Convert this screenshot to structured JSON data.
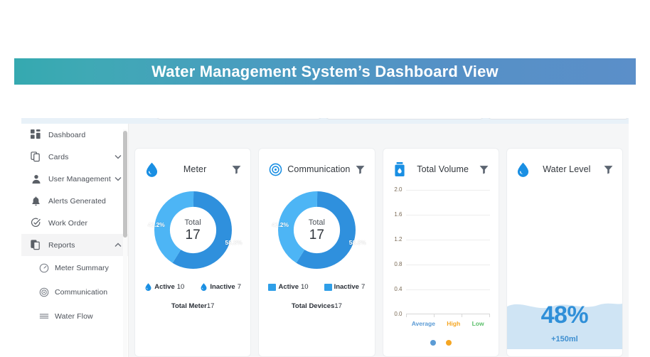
{
  "banner": {
    "title": "Water Management System’s Dashboard View"
  },
  "theme": {
    "banner_gradient_start": "#35a9b0",
    "banner_gradient_end": "#5b8fc9",
    "accent_blue": "#1a8fe3",
    "donut_dark": "#2f90dd",
    "donut_light": "#4db5f5",
    "water_fill": "#cfe4f4",
    "water_text": "#2f8fd8"
  },
  "sidebar": {
    "items": [
      {
        "label": "Dashboard",
        "icon": "dashboard-grid-icon",
        "chevron": "",
        "active": false
      },
      {
        "label": "Cards",
        "icon": "cards-copy-icon",
        "chevron": "down",
        "active": false
      },
      {
        "label": "User Management",
        "icon": "user-icon",
        "chevron": "down",
        "active": false
      },
      {
        "label": "Alerts Generated",
        "icon": "bell-icon",
        "chevron": "",
        "active": false
      },
      {
        "label": "Work Order",
        "icon": "check-circle-icon",
        "chevron": "",
        "active": false
      },
      {
        "label": "Reports",
        "icon": "reports-document-icon",
        "chevron": "up",
        "active": true
      }
    ],
    "sub_items": [
      {
        "label": "Meter Summary",
        "icon": "gauge-icon"
      },
      {
        "label": "Communication",
        "icon": "signal-icon"
      },
      {
        "label": "Water Flow",
        "icon": "flow-lines-icon"
      }
    ]
  },
  "cards": [
    {
      "id": "meter",
      "title": "Meter",
      "icon": "water-drop-icon",
      "filter_icon": "filter-funnel-icon",
      "center_label": "Total",
      "center_value": "17",
      "legend_marker": "drop",
      "legend": [
        {
          "label": "Active",
          "value": "10"
        },
        {
          "label": "Inactive",
          "value": "7"
        }
      ],
      "footer_label": "Total Meter",
      "footer_value": "17"
    },
    {
      "id": "communication",
      "title": "Communication",
      "icon": "signal-icon",
      "filter_icon": "filter-funnel-icon",
      "center_label": "Total",
      "center_value": "17",
      "legend_marker": "square",
      "legend": [
        {
          "label": "Active",
          "value": "10"
        },
        {
          "label": "Inactive",
          "value": "7"
        }
      ],
      "footer_label": "Total Devices",
      "footer_value": "17"
    },
    {
      "id": "total-volume",
      "title": "Total Volume",
      "icon": "water-bottle-icon",
      "filter_icon": "filter-funnel-icon"
    },
    {
      "id": "water-level",
      "title": "Water Level",
      "icon": "water-drop-icon",
      "filter_icon": "filter-funnel-icon",
      "percent": "48%",
      "delta": "+150ml"
    }
  ],
  "chart_data": [
    {
      "type": "pie",
      "title": "Meter",
      "categories": [
        "Inactive",
        "Active"
      ],
      "values": [
        7,
        10
      ],
      "percents": [
        "41.2%",
        "58.8%"
      ],
      "colors": [
        "#4db5f5",
        "#2f90dd"
      ],
      "total": 17,
      "center_label": "Total",
      "legend_position": "bottom"
    },
    {
      "type": "pie",
      "title": "Communication",
      "categories": [
        "Inactive",
        "Active"
      ],
      "values": [
        7,
        10
      ],
      "percents": [
        "41.2%",
        "58.8%"
      ],
      "colors": [
        "#4db5f5",
        "#2f90dd"
      ],
      "total": 17,
      "center_label": "Total",
      "legend_position": "bottom"
    },
    {
      "type": "bar",
      "title": "Total Volume",
      "categories": [
        "Average",
        "High",
        "Low"
      ],
      "values": [
        0,
        0,
        0
      ],
      "category_colors": [
        "#5b9bd5",
        "#f5a623",
        "#5bbf6a"
      ],
      "ylim": [
        0.0,
        2.0
      ],
      "yticks": [
        "0.0",
        "0.4",
        "0.8",
        "1.2",
        "1.6",
        "2.0"
      ],
      "xlabel": "",
      "ylabel": "",
      "grid": true,
      "legend_position": "bottom"
    }
  ]
}
